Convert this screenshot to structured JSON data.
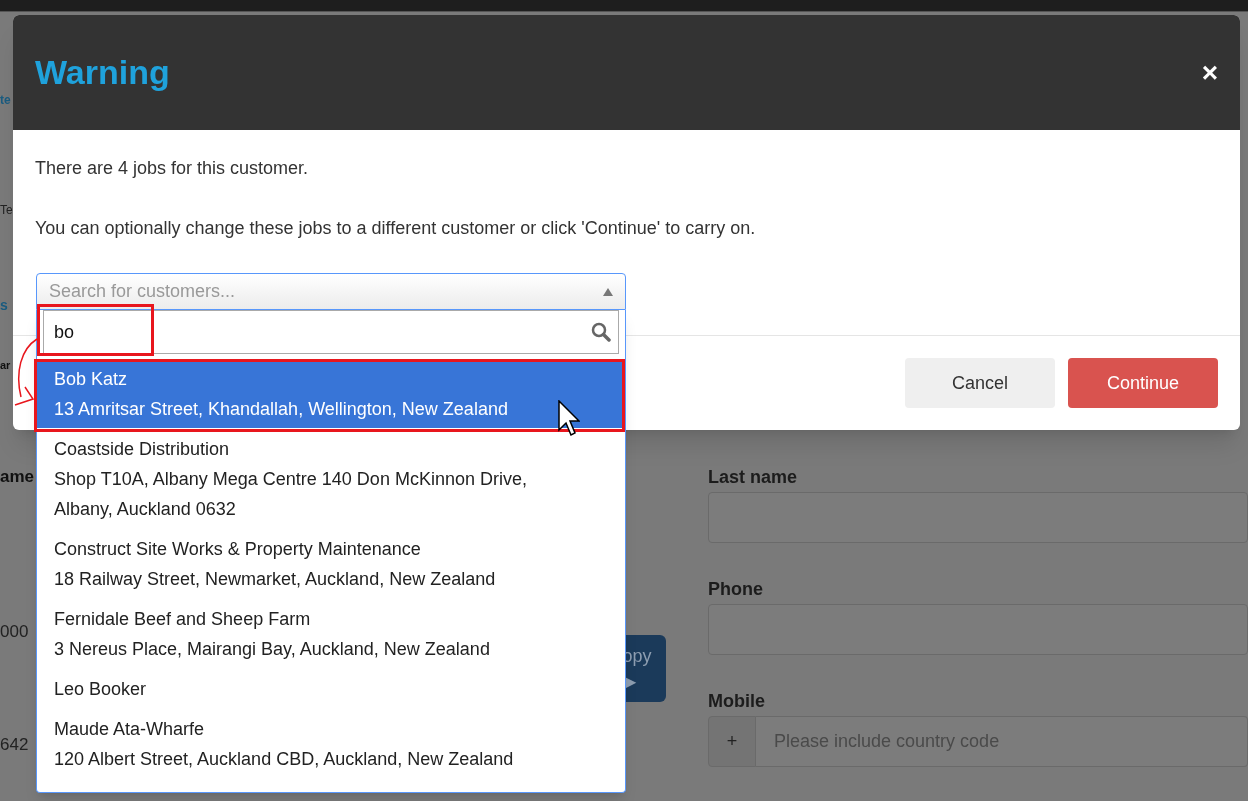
{
  "page": {
    "left_fragments": [
      "te",
      "Te",
      "s",
      "ar",
      "ame",
      "000",
      "642"
    ],
    "copy_button": {
      "label": "opy",
      "icon": "▶"
    },
    "fields": [
      {
        "label": "Last name",
        "kind": "text"
      },
      {
        "label": "Phone",
        "kind": "text"
      },
      {
        "label": "Mobile",
        "kind": "phone",
        "prefix": "+",
        "placeholder": "Please include country code"
      }
    ]
  },
  "dialog": {
    "title": "Warning",
    "close": "×",
    "messages": [
      "There are 4 jobs for this customer.",
      "You can optionally change these jobs to a different customer or click 'Continue' to carry on."
    ],
    "customer_select": {
      "placeholder": "Search for customers...",
      "expanded": true,
      "search_value": "bo",
      "options": [
        {
          "name": "Bob Katz",
          "address": "13 Amritsar Street, Khandallah, Wellington, New Zealand",
          "selected": true
        },
        {
          "name": "Coastside Distribution",
          "address": "Shop T10A, Albany Mega Centre 140 Don McKinnon Drive, Albany, Auckland 0632",
          "selected": false
        },
        {
          "name": "Construct Site Works & Property Maintenance",
          "address": "18 Railway Street, Newmarket, Auckland, New Zealand",
          "selected": false
        },
        {
          "name": "Fernidale Beef and Sheep Farm",
          "address": "3 Nereus Place, Mairangi Bay, Auckland, New Zealand",
          "selected": false
        },
        {
          "name": "Leo Booker",
          "selected": false
        },
        {
          "name": "Maude Ata-Wharfe",
          "address": "120 Albert Street, Auckland CBD, Auckland, New Zealand",
          "selected": false
        }
      ]
    },
    "buttons": [
      {
        "label": "Cancel",
        "kind": "default"
      },
      {
        "label": "Continue",
        "kind": "danger"
      }
    ]
  }
}
